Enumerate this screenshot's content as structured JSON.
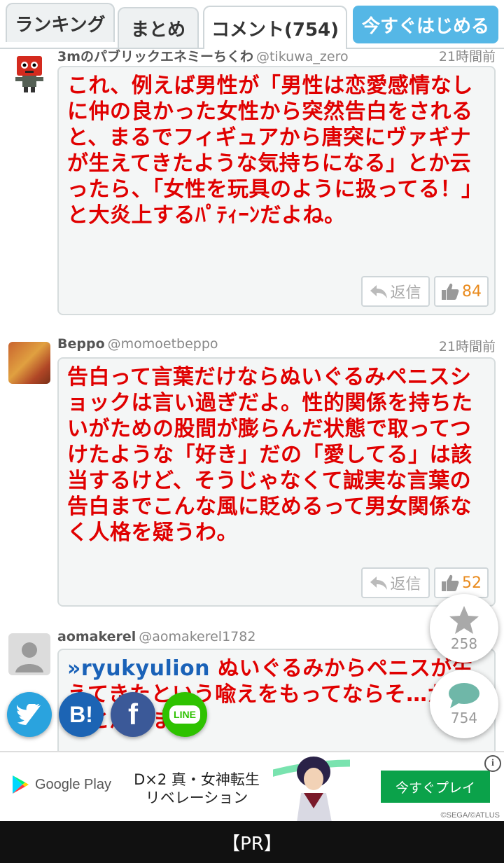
{
  "tabs": [
    {
      "label": "ランキング"
    },
    {
      "label": "まとめ"
    },
    {
      "label": "コメント(754)"
    }
  ],
  "start_button": "今すぐはじめる",
  "comments": [
    {
      "username": "3mのパブリックエネミーちくわ",
      "handle": "@tikuwa_zero",
      "time": "21時間前",
      "reply_to": "",
      "body": "これ、例えば男性が「男性は恋愛感情なしに仲の良かった女性から突然告白をされると、まるでフィギュアから唐突にヴァギナが生えてきたような気持ちになる」とか云ったら、「女性を玩具のように扱ってる！」と大炎上するﾊﾟﾃｨｰﾝだよね。",
      "reply_label": "返信",
      "likes": "84"
    },
    {
      "username": "Beppo",
      "handle": "@momoetbeppo",
      "time": "21時間前",
      "reply_to": "",
      "body": "告白って言葉だけならぬいぐるみペニスショックは言い過ぎだよ。性的関係を持ちたいがための股間が膨らんだ状態で取ってつけたような「好き」だの「愛してる」は該当するけど、そうじゃなくて誠実な言葉の告白までこんな風に貶めるって男女関係なく人格を疑うわ。",
      "reply_label": "返信",
      "likes": "52"
    },
    {
      "username": "aomakerel",
      "handle": "@aomakerel1782",
      "time": "",
      "reply_to": "»ryukyulion",
      "body": "ぬいぐるみからペニスが生えてきたという喩えをもってならそ…か…いと思います",
      "reply_label": "返信",
      "likes": ""
    }
  ],
  "fab": {
    "favorites_count": "258",
    "comments_count": "754"
  },
  "share": {
    "hatena_label": "B!",
    "facebook_label": "f",
    "line_label": "LINE"
  },
  "ad": {
    "store_label": "Google Play",
    "game_title": "D×2 真・女神転生 リベレーション",
    "cta_label": "今すぐプレイ",
    "copyright": "©SEGA/©ATLUS"
  },
  "pr_label": "【PR】",
  "colors": {
    "accent": "#55b7e6",
    "comment_text": "#e00000",
    "like_count": "#e98a1c",
    "reply_link": "#1a62b8",
    "twitter": "#2aa3de",
    "hatena": "#1c64b4",
    "facebook": "#3b5998",
    "line": "#2ec200",
    "ad_cta": "#0ba24a"
  },
  "icons": [
    "reply-icon",
    "thumbs-up-icon",
    "star-icon",
    "speech-bubble-icon",
    "twitter-bird-icon",
    "google-play-icon",
    "info-icon"
  ]
}
